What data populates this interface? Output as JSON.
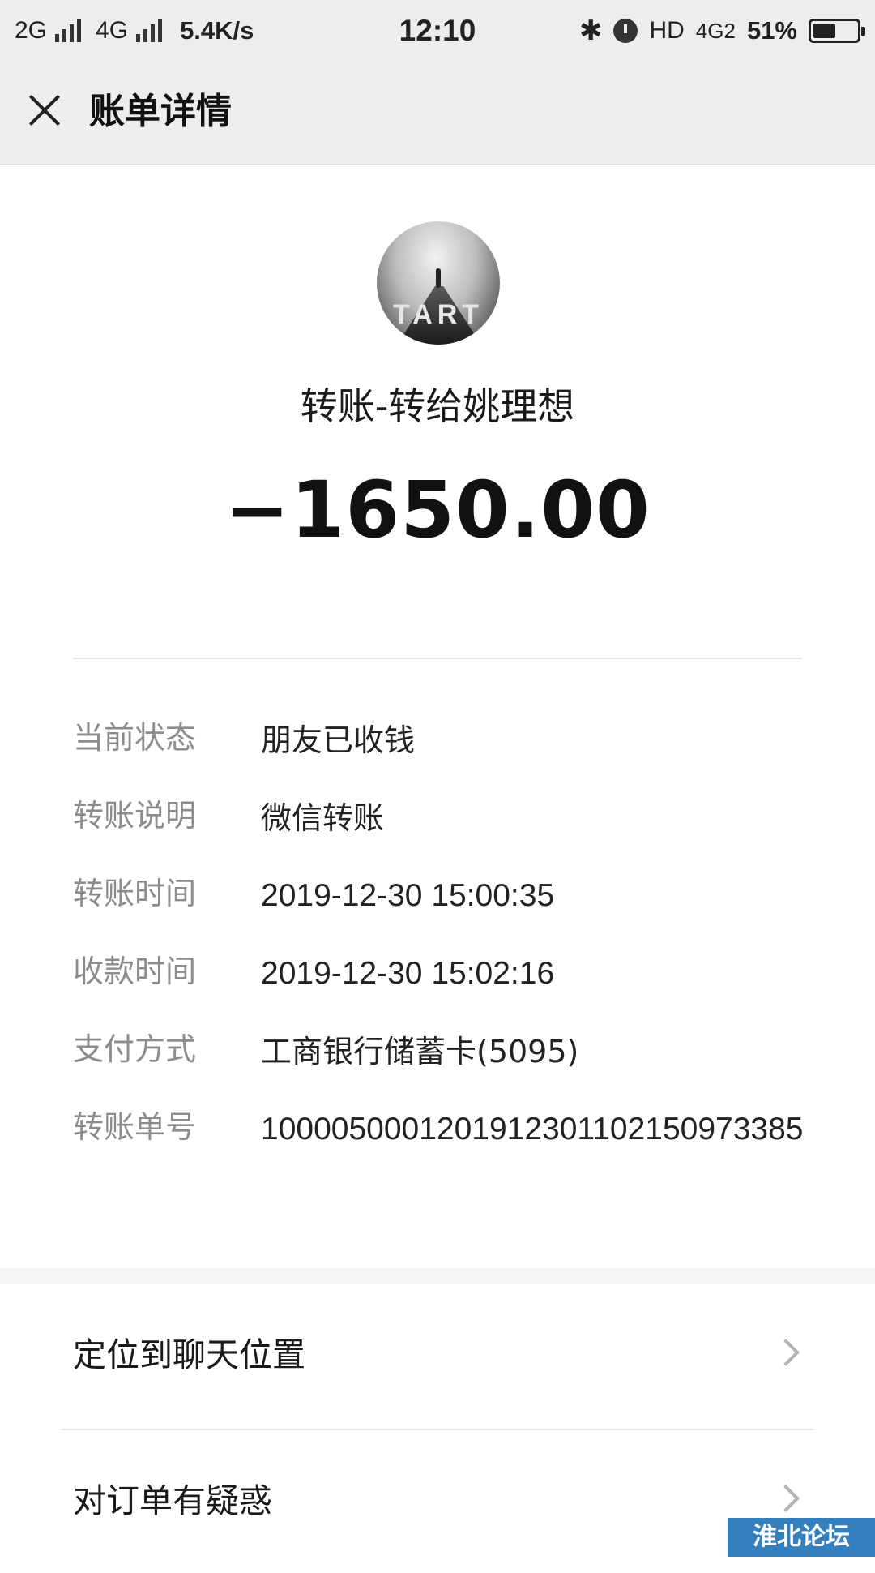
{
  "status_bar": {
    "net1": "2G",
    "net2": "4G",
    "speed": "5.4K/s",
    "time": "12:10",
    "hd": "HD",
    "net3": "4G2",
    "battery_pct": "51%",
    "battery_level": 0.51
  },
  "nav": {
    "title": "账单详情",
    "close_icon": "close-icon"
  },
  "header": {
    "payee": "转账-转给姚理想",
    "amount": "−1650.00",
    "avatar_text": "TART"
  },
  "details": [
    {
      "key": "当前状态",
      "value": "朋友已收钱"
    },
    {
      "key": "转账说明",
      "value": "微信转账"
    },
    {
      "key": "转账时间",
      "value": "2019-12-30 15:00:35"
    },
    {
      "key": "收款时间",
      "value": "2019-12-30 15:02:16"
    },
    {
      "key": "支付方式",
      "value": "工商银行储蓄卡(5095)"
    },
    {
      "key": "转账单号",
      "value": "1000050001201912301102150973385"
    }
  ],
  "actions": [
    {
      "label": "定位到聊天位置",
      "icon": "chevron-right-icon"
    },
    {
      "label": "对订单有疑惑",
      "icon": "chevron-right-icon"
    }
  ],
  "watermark": "淮北论坛",
  "colors": {
    "nav_bg": "#ededed",
    "label_gray": "#8c8c8c",
    "text_dark": "#1a1a1a",
    "watermark_blue": "#1f73b8"
  }
}
